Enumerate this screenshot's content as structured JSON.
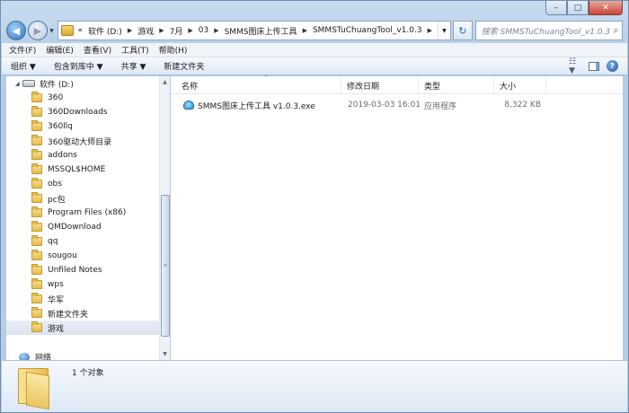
{
  "window": {
    "minimize": "–",
    "maximize": "□",
    "close": "✕"
  },
  "nav": {
    "back_icon": "◀",
    "forward_icon": "▶",
    "history_dropdown": "▼",
    "breadcrumb": [
      "«",
      "软件 (D:)",
      "游戏",
      "7月",
      "03",
      "SMMS图床上传工具",
      "SMMSTuChuangTool_v1.0.3"
    ],
    "breadcrumb_sep": "▶",
    "address_dropdown": "▼",
    "refresh_icon": "↻",
    "search_placeholder": "搜索 SMMSTuChuangTool_v1.0.3",
    "search_icon": "⌕"
  },
  "menu": [
    "文件(F)",
    "编辑(E)",
    "查看(V)",
    "工具(T)",
    "帮助(H)"
  ],
  "toolbar": {
    "organize": "组织 ▼",
    "include_in_library": "包含到库中 ▼",
    "share": "共享 ▼",
    "new_folder": "新建文件夹",
    "view_icon": "☷ ▼",
    "help_icon": "?"
  },
  "tree": {
    "drive_label": "软件 (D:)",
    "drive_expander": "◢",
    "folders": [
      "360",
      "360Downloads",
      "360llq",
      "360驱动大师目录",
      "addons",
      "MSSQL$HOME",
      "obs",
      "pc包",
      "Program Files (x86)",
      "QMDownload",
      "qq",
      "sougou",
      "Unfiled Notes",
      "wps",
      "华军",
      "新建文件夹",
      "游戏"
    ],
    "selected": "游戏",
    "network": "网络"
  },
  "columns": {
    "name": "名称",
    "modified": "修改日期",
    "type": "类型",
    "size": "大小",
    "sort_indicator": "^"
  },
  "files": [
    {
      "name": "SMMS图床上传工具 v1.0.3.exe",
      "modified": "2019-03-03 16:01",
      "type": "应用程序",
      "size": "8,322 KB"
    }
  ],
  "scrollbar": {
    "up": "▲",
    "down": "▼",
    "grip": "≡"
  },
  "details": {
    "count": "1 个对象"
  }
}
